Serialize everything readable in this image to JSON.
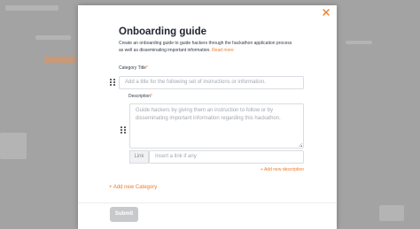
{
  "modal": {
    "title": "Onboarding guide",
    "description": "Create an onboarding guide to guide hackers through the hackathon application process as well as disseminating important information.",
    "read_more": "Read more",
    "close_icon": "close-icon",
    "accent_color": "#f07a28"
  },
  "category": {
    "label": "Category Title",
    "required_mark": "*",
    "placeholder": "Add a title for the following set of instructions or information.",
    "value": ""
  },
  "description_field": {
    "label": "Description",
    "required_mark": "*",
    "placeholder": "Guide hackers by giving them an instruction to follow or by disseminating important information regarding this hackathon.",
    "value": ""
  },
  "link_field": {
    "tag": "Link",
    "placeholder": "Insert a link if any",
    "value": ""
  },
  "actions": {
    "add_description": "+ Add new description",
    "add_category": "+ Add new Category",
    "submit": "Submit"
  }
}
